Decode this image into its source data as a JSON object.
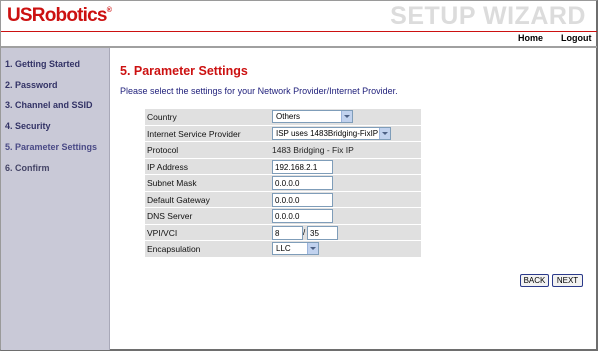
{
  "header": {
    "logo_text": "USRobotics",
    "logo_mark": "®",
    "wizard_title": "SETUP WIZARD"
  },
  "topnav": {
    "home": "Home",
    "logout": "Logout"
  },
  "sidebar": {
    "items": [
      {
        "label": "1. Getting Started"
      },
      {
        "label": "2. Password"
      },
      {
        "label": "3. Channel and SSID"
      },
      {
        "label": "4. Security"
      },
      {
        "label": "5. Parameter Settings"
      },
      {
        "label": "6. Confirm"
      }
    ]
  },
  "main": {
    "title": "5. Parameter Settings",
    "instruction": "Please select the settings for your Network Provider/Internet Provider.",
    "fields": {
      "country": {
        "label": "Country",
        "value": "Others"
      },
      "isp": {
        "label": "Internet Service Provider",
        "value": "ISP uses 1483Bridging-FixIP"
      },
      "protocol": {
        "label": "Protocol",
        "value": "1483 Bridging - Fix IP"
      },
      "ip_address": {
        "label": "IP Address",
        "value": "192.168.2.1"
      },
      "subnet_mask": {
        "label": "Subnet Mask",
        "value": "0.0.0.0"
      },
      "default_gateway": {
        "label": "Default Gateway",
        "value": "0.0.0.0"
      },
      "dns_server": {
        "label": "DNS Server",
        "value": "0.0.0.0"
      },
      "vpi_vci": {
        "label": "VPI/VCI",
        "vpi": "8",
        "separator": "/",
        "vci": "35"
      },
      "encapsulation": {
        "label": "Encapsulation",
        "value": "LLC"
      }
    },
    "buttons": {
      "back": "BACK",
      "next": "NEXT"
    }
  },
  "colors": {
    "brand_red": "#cc1111",
    "sidebar_bg": "#c9c9d7",
    "sidebar_text": "#2d2d6e",
    "form_row_bg": "#e0e0e0"
  }
}
